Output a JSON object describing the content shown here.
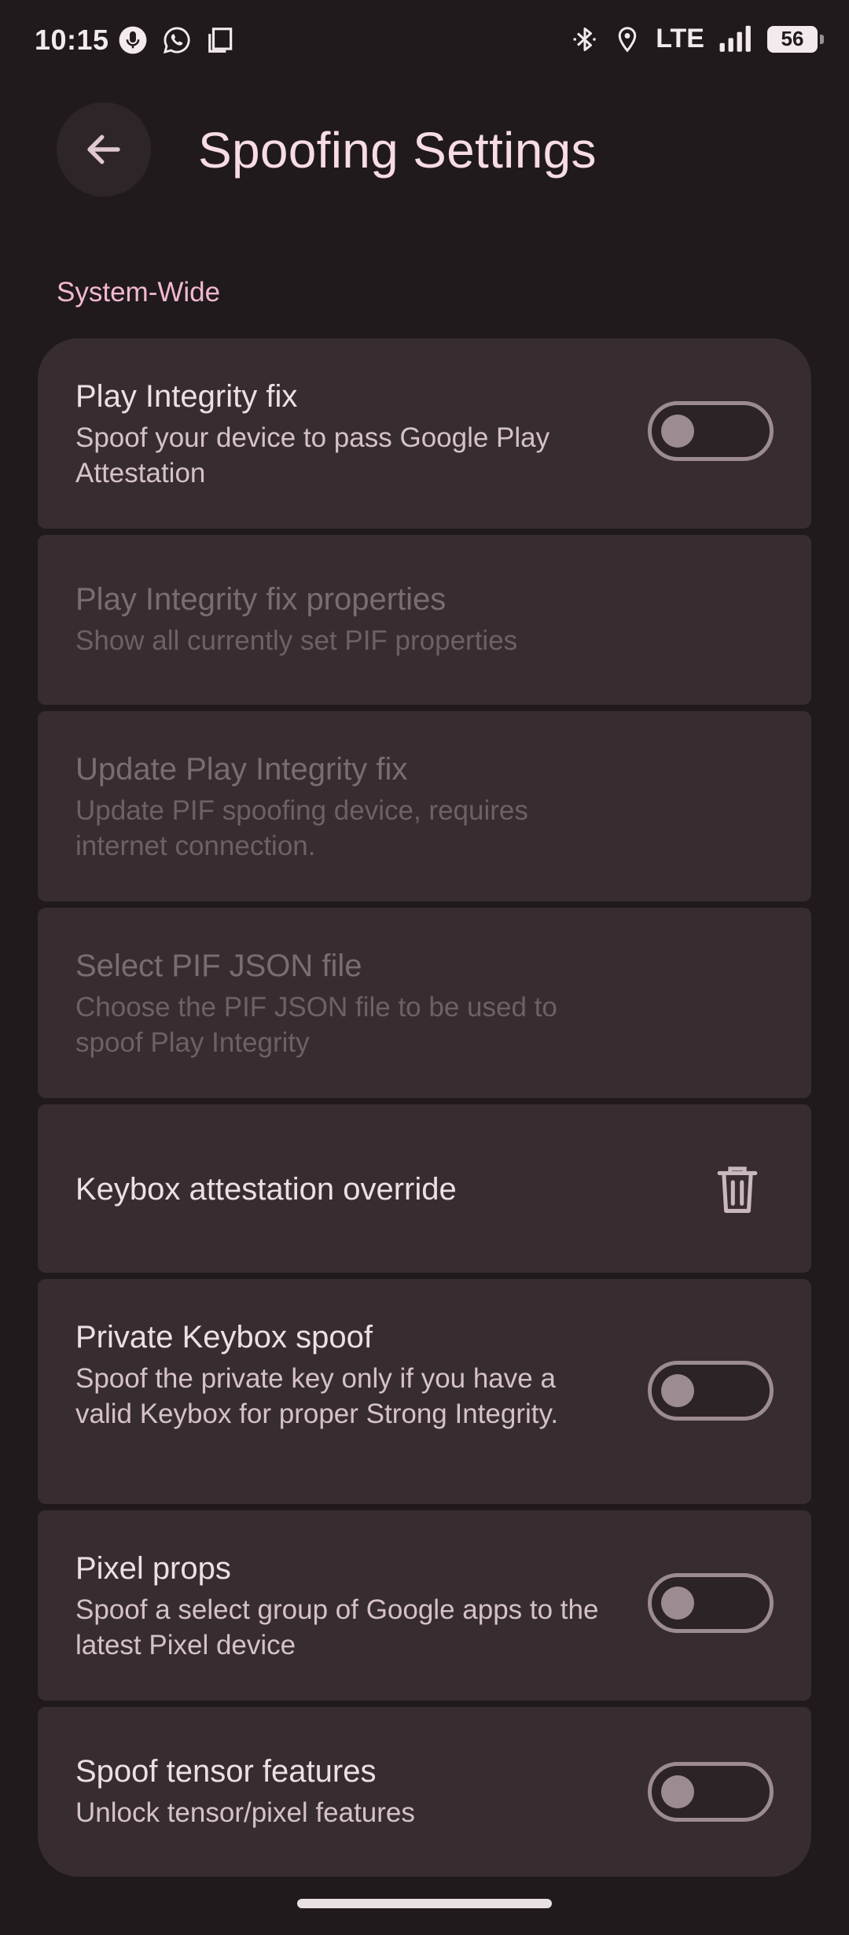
{
  "status": {
    "time": "10:15",
    "network": "LTE",
    "battery": "56",
    "icons": [
      "mic-notification-icon",
      "whatsapp-icon",
      "screenshot-icon",
      "bluetooth-icon",
      "location-icon",
      "signal-icon",
      "battery-icon"
    ]
  },
  "app_bar": {
    "title": "Spoofing Settings",
    "back_icon": "arrow-left-icon"
  },
  "section": {
    "header": "System-Wide"
  },
  "items": [
    {
      "title": "Play Integrity fix",
      "subtitle": "Spoof your device to pass Google Play Attestation",
      "control": "toggle",
      "checked": false,
      "enabled": true
    },
    {
      "title": "Play Integrity fix properties",
      "subtitle": "Show all currently set PIF properties",
      "control": "none",
      "enabled": false
    },
    {
      "title": "Update Play Integrity fix",
      "subtitle": "Update PIF spoofing device, requires internet connection.",
      "control": "none",
      "enabled": false
    },
    {
      "title": "Select PIF JSON file",
      "subtitle": "Choose the PIF JSON file to be used to spoof Play Integrity",
      "control": "none",
      "enabled": false
    },
    {
      "title": "Keybox attestation override",
      "subtitle": "",
      "control": "trash-icon",
      "enabled": true
    },
    {
      "title": "Private Keybox spoof",
      "subtitle": "Spoof the private key only if you have a valid Keybox for proper Strong Integrity.",
      "control": "toggle",
      "checked": false,
      "enabled": true
    },
    {
      "title": "Pixel props",
      "subtitle": "Spoof a select group of Google apps to the latest Pixel device",
      "control": "toggle",
      "checked": false,
      "enabled": true
    },
    {
      "title": "Spoof tensor features",
      "subtitle": "Unlock tensor/pixel features",
      "control": "toggle",
      "checked": false,
      "enabled": true
    }
  ],
  "colors": {
    "background": "#201a1c",
    "card": "#372c30",
    "accent": "#f2b8d2",
    "title": "#f7dbe6"
  }
}
